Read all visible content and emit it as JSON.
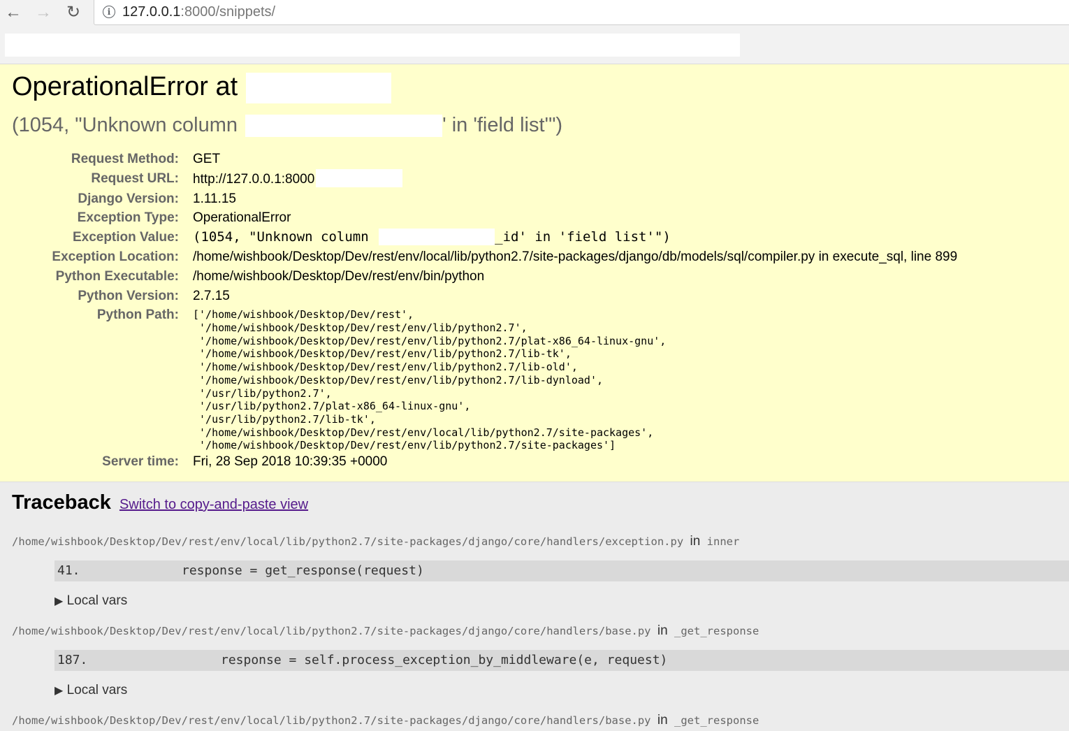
{
  "browser": {
    "url_host": "127.0.0.1",
    "url_rest": ":8000/snippets/"
  },
  "error": {
    "title_prefix": "OperationalError at",
    "subtitle_prefix": "(1054, \"Unknown column",
    "subtitle_suffix": "' in 'field list'\")"
  },
  "meta": [
    {
      "label": "Request Method:",
      "value": "GET"
    },
    {
      "label": "Request URL:",
      "value": "http://127.0.0.1:8000"
    },
    {
      "label": "Django Version:",
      "value": "1.11.15"
    },
    {
      "label": "Exception Type:",
      "value": "OperationalError"
    },
    {
      "label": "Exception Value:",
      "value_prefix": "(1054, \"Unknown column",
      "value_suffix": "_id' in 'field list'\")"
    },
    {
      "label": "Exception Location:",
      "value": "/home/wishbook/Desktop/Dev/rest/env/local/lib/python2.7/site-packages/django/db/models/sql/compiler.py in execute_sql, line 899"
    },
    {
      "label": "Python Executable:",
      "value": "/home/wishbook/Desktop/Dev/rest/env/bin/python"
    },
    {
      "label": "Python Version:",
      "value": "2.7.15"
    },
    {
      "label": "Python Path:",
      "value": "['/home/wishbook/Desktop/Dev/rest',\n '/home/wishbook/Desktop/Dev/rest/env/lib/python2.7',\n '/home/wishbook/Desktop/Dev/rest/env/lib/python2.7/plat-x86_64-linux-gnu',\n '/home/wishbook/Desktop/Dev/rest/env/lib/python2.7/lib-tk',\n '/home/wishbook/Desktop/Dev/rest/env/lib/python2.7/lib-old',\n '/home/wishbook/Desktop/Dev/rest/env/lib/python2.7/lib-dynload',\n '/usr/lib/python2.7',\n '/usr/lib/python2.7/plat-x86_64-linux-gnu',\n '/usr/lib/python2.7/lib-tk',\n '/home/wishbook/Desktop/Dev/rest/env/local/lib/python2.7/site-packages',\n '/home/wishbook/Desktop/Dev/rest/env/lib/python2.7/site-packages']"
    },
    {
      "label": "Server time:",
      "value": "Fri, 28 Sep 2018 10:39:35 +0000"
    }
  ],
  "traceback": {
    "heading": "Traceback",
    "switch_label": "Switch to copy-and-paste view",
    "in_word": "in",
    "local_vars_label": "Local vars",
    "frames": [
      {
        "file": "/home/wishbook/Desktop/Dev/rest/env/local/lib/python2.7/site-packages/django/core/handlers/exception.py",
        "func": "inner",
        "lineno": "41.",
        "code": "response = get_response(request)"
      },
      {
        "file": "/home/wishbook/Desktop/Dev/rest/env/local/lib/python2.7/site-packages/django/core/handlers/base.py",
        "func": "_get_response",
        "lineno": "187.",
        "code": "response = self.process_exception_by_middleware(e, request)"
      },
      {
        "file": "/home/wishbook/Desktop/Dev/rest/env/local/lib/python2.7/site-packages/django/core/handlers/base.py",
        "func": "_get_response"
      }
    ]
  }
}
